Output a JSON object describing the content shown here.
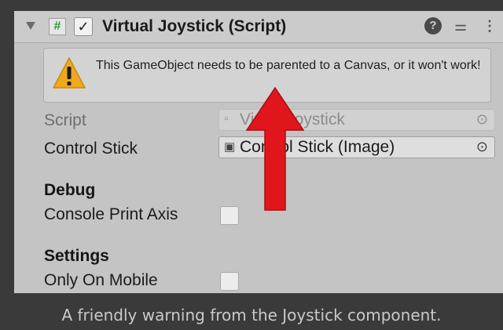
{
  "component": {
    "title": "Virtual Joystick (Script)",
    "script_icon": "#",
    "enabled_check": "✓",
    "help_icon": "?",
    "presets_icon": "⚌",
    "menu_icon": "⋮"
  },
  "warning": {
    "text": "This GameObject needs to be parented to a Canvas, or it won't work!",
    "icon": "warning-triangle-icon"
  },
  "fields": {
    "script_label": "Script",
    "script_value": "VirtualJoystick",
    "control_stick_label": "Control Stick",
    "control_stick_value": "Control Stick (Image)",
    "picker_glyph": "⊙"
  },
  "debug": {
    "header": "Debug",
    "console_print_axis_label": "Console Print Axis",
    "console_print_axis_checked": false
  },
  "settings": {
    "header": "Settings",
    "only_on_mobile_label": "Only On Mobile",
    "only_on_mobile_checked": false
  },
  "annotation": {
    "arrow_color": "#e0161c"
  },
  "caption": "A friendly warning from the Joystick component."
}
